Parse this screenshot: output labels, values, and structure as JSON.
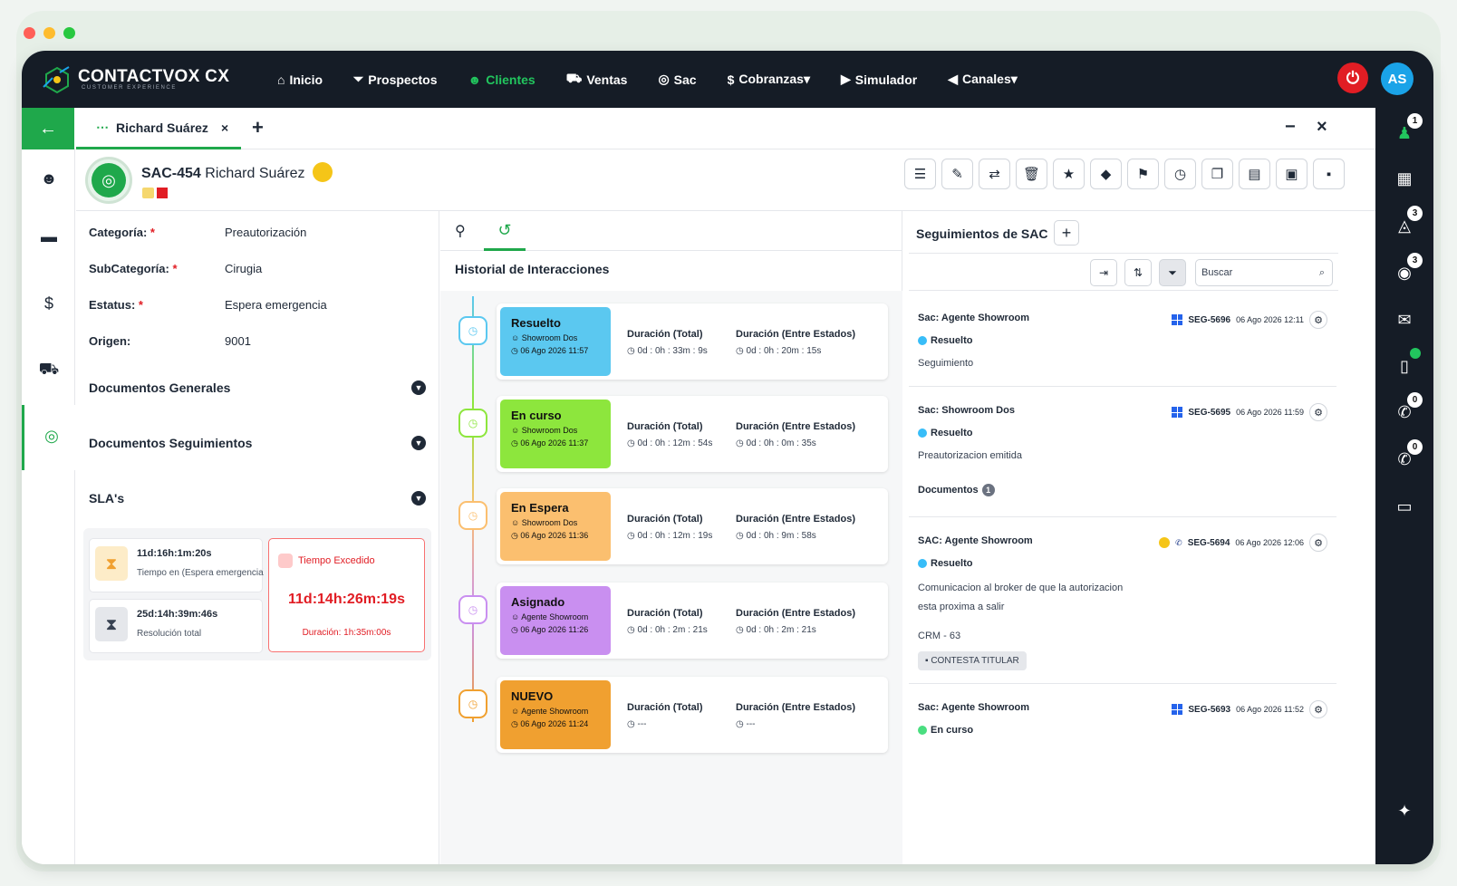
{
  "app": {
    "logo_main": "CONTACTVOX CX",
    "logo_sub": "CUSTOMER EXPERIENCE"
  },
  "nav": {
    "items": [
      {
        "label": "Inicio"
      },
      {
        "label": "Prospectos"
      },
      {
        "label": "Clientes"
      },
      {
        "label": "Ventas"
      },
      {
        "label": "Sac"
      },
      {
        "label": "Cobranzas▾"
      },
      {
        "label": "Simulador"
      },
      {
        "label": "Canales▾"
      }
    ],
    "user_initials": "AS",
    "active_color": "#22c55e"
  },
  "rightbar": {
    "badges": [
      "1",
      "3",
      "3",
      "0",
      "0"
    ]
  },
  "tab": {
    "label": "Richard Suárez",
    "close": "×",
    "add": "+",
    "minimize": "−",
    "close_window": "×"
  },
  "header": {
    "code": "SAC-454",
    "name": "Richard Suárez"
  },
  "form": {
    "categoria_label": "Categoría:",
    "categoria": "Preautorización",
    "subcategoria_label": "SubCategoría:",
    "subcategoria": "Cirugia",
    "estatus_label": "Estatus:",
    "estatus": "Espera emergencia",
    "origen_label": "Origen:",
    "origen": "9001",
    "req": "*"
  },
  "sections": [
    "Documentos Generales",
    "Documentos Seguimientos",
    "SLA's"
  ],
  "sla": {
    "card1_time": "11d:16h:1m:20s",
    "card1_desc": "Tiempo en (Espera emergencia)",
    "card2_time": "25d:14h:39m:46s",
    "card2_desc": "Resolución total",
    "exceeded_label": "Tiempo Excedido",
    "exceeded_time": "11d:14h:26m:19s",
    "exceeded_duration": "Duración: 1h:35m:00s"
  },
  "history": {
    "title": "Historial de Interacciones",
    "dur_total_label": "Duración (Total)",
    "dur_states_label": "Duración (Entre Estados)",
    "items": [
      {
        "status": "Resuelto",
        "user": "Showroom Dos",
        "date": "06 Ago 2026 11:57",
        "total": "0d : 0h : 33m : 9s",
        "between": "0d : 0h : 20m : 15s",
        "color": "#5bc8f0"
      },
      {
        "status": "En curso",
        "user": "Showroom Dos",
        "date": "06 Ago 2026 11:37",
        "total": "0d : 0h : 12m : 54s",
        "between": "0d : 0h : 0m : 35s",
        "color": "#8de63d"
      },
      {
        "status": "En Espera",
        "user": "Showroom Dos",
        "date": "06 Ago 2026 11:36",
        "total": "0d : 0h : 12m : 19s",
        "between": "0d : 0h : 9m : 58s",
        "color": "#fbbf6f"
      },
      {
        "status": "Asignado",
        "user": "Agente Showroom",
        "date": "06 Ago 2026 11:26",
        "total": "0d : 0h : 2m : 21s",
        "between": "0d : 0h : 2m : 21s",
        "color": "#c98ff0"
      },
      {
        "status": "NUEVO",
        "user": "Agente Showroom",
        "date": "06 Ago 2026 11:24",
        "total": "---",
        "between": "---",
        "color": "#f0a030"
      }
    ]
  },
  "followups": {
    "title": "Seguimientos de SAC",
    "add": "+",
    "search_placeholder": "Buscar",
    "docs_label": "Documentos",
    "docs_count": "1",
    "items": [
      {
        "title": "Sac: Agente Showroom",
        "code": "SEG-5696",
        "date": "06 Ago 2026 12:11",
        "status": "Resuelto",
        "text": "Seguimiento"
      },
      {
        "title": "Sac: Showroom Dos",
        "code": "SEG-5695",
        "date": "06 Ago 2026 11:59",
        "status": "Resuelto",
        "text": "Preautorizacion emitida"
      },
      {
        "title": "SAC: Agente Showroom",
        "code": "SEG-5694",
        "date": "06 Ago 2026 12:06",
        "status": "Resuelto",
        "text": "Comunicacion al broker de que la autorizacion",
        "text2": "esta proxima a salir",
        "crm": "CRM - 63",
        "tag": "CONTESTA TITULAR"
      },
      {
        "title": "Sac: Agente Showroom",
        "code": "SEG-5693",
        "date": "06 Ago 2026 11:52",
        "status": "En curso"
      }
    ]
  }
}
